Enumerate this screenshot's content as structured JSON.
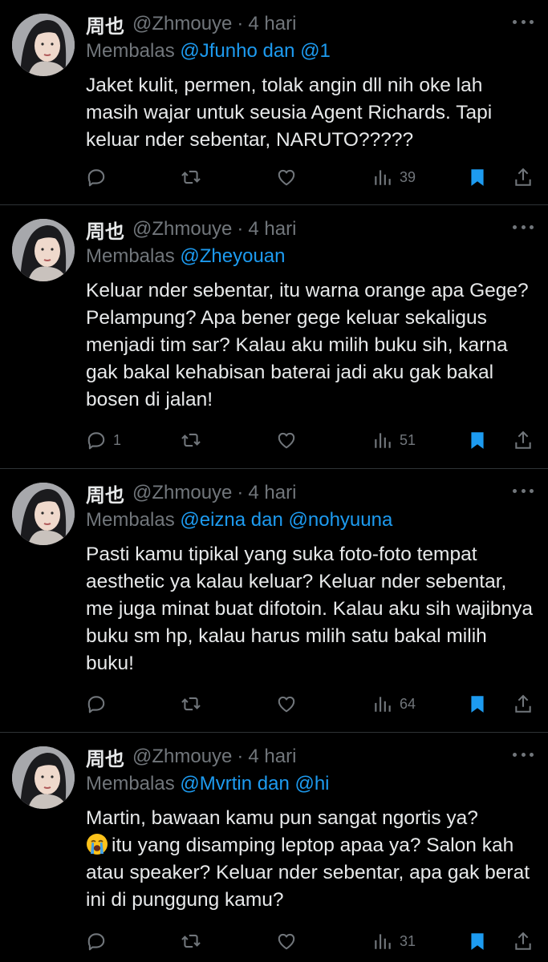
{
  "tweets": [
    {
      "name": "周也",
      "handle": "@Zhmouye",
      "sep": "·",
      "time": "4 hari",
      "reply_prefix": "Membalas",
      "reply_to": "@Jfunho dan @1",
      "text": "Jaket kulit, permen, tolak angin dll nih oke lah masih wajar untuk seusia Agent Richards. Tapi keluar nder sebentar, NARUTO?????",
      "replies": "",
      "views": "39"
    },
    {
      "name": "周也",
      "handle": "@Zhmouye",
      "sep": "·",
      "time": "4 hari",
      "reply_prefix": "Membalas",
      "reply_to": "@Zheyouan",
      "text": "Keluar nder sebentar, itu warna orange apa Gege? Pelampung? Apa bener gege keluar sekaligus menjadi tim sar? Kalau aku milih buku sih, karna gak bakal kehabisan baterai jadi aku gak bakal bosen di jalan!",
      "replies": "1",
      "views": "51"
    },
    {
      "name": "周也",
      "handle": "@Zhmouye",
      "sep": "·",
      "time": "4 hari",
      "reply_prefix": "Membalas",
      "reply_to": "@eizna dan @nohyuuna",
      "text": "Pasti kamu tipikal yang suka foto-foto tempat aesthetic ya kalau keluar? Keluar nder sebentar, me juga minat buat difotoin. Kalau aku sih wajibnya buku sm hp, kalau harus milih satu bakal milih buku!",
      "replies": "",
      "views": "64"
    },
    {
      "name": "周也",
      "handle": "@Zhmouye",
      "sep": "·",
      "time": "4 hari",
      "reply_prefix": "Membalas",
      "reply_to": "@Mvrtin dan @hi",
      "text_a": "Martin, bawaan kamu pun sangat ngortis ya?",
      "text_b": "itu yang disamping leptop apaa ya? Salon kah atau speaker? Keluar nder sebentar, apa gak berat ini di punggung kamu?",
      "emoji": "loudly-crying-face",
      "replies": "",
      "views": "31"
    }
  ],
  "colors": {
    "background": "#000000",
    "text": "#e7e9ea",
    "muted": "#71767b",
    "accent": "#1d9bf0",
    "divider": "#2f3336"
  },
  "icons": [
    "reply-icon",
    "retweet-icon",
    "like-icon",
    "views-icon",
    "bookmark-icon",
    "share-icon",
    "more-icon"
  ]
}
